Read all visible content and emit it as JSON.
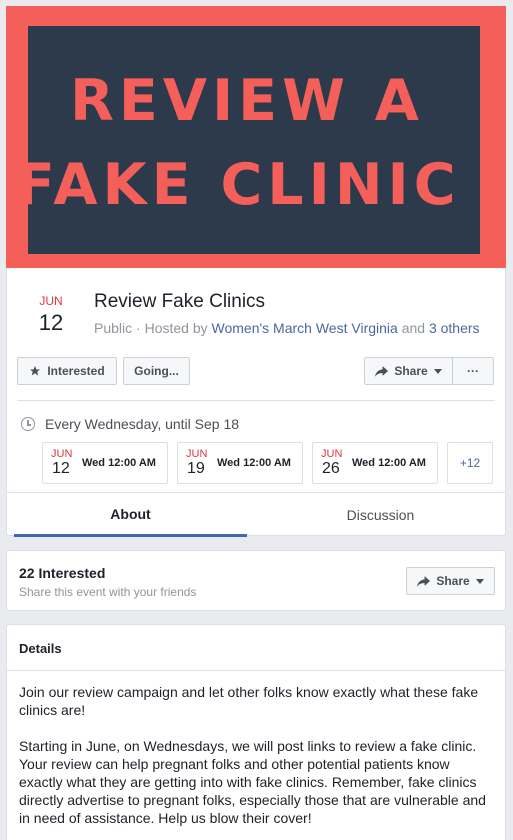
{
  "cover": {
    "line1": "REVIEW A",
    "line2": "FAKE CLINIC",
    "colors": {
      "frame": "#f45f5a",
      "panel": "#2c3a4b"
    }
  },
  "event": {
    "month": "JUN",
    "day": "12",
    "title": "Review Fake Clinics",
    "privacy": "Public",
    "hosted_by_prefix": " · Hosted by ",
    "host": "Women's March West Virginia",
    "and_text": " and ",
    "others": "3 others"
  },
  "actions": {
    "interested": "Interested",
    "going": "Going...",
    "share": "Share",
    "more": "···"
  },
  "recurrence": {
    "text": "Every Wednesday, until Sep 18",
    "occurrences": [
      {
        "month": "JUN",
        "day": "12",
        "time": "Wed 12:00 AM"
      },
      {
        "month": "JUN",
        "day": "19",
        "time": "Wed 12:00 AM"
      },
      {
        "month": "JUN",
        "day": "26",
        "time": "Wed 12:00 AM"
      }
    ],
    "more": "+12"
  },
  "tabs": [
    {
      "label": "About"
    },
    {
      "label": "Discussion"
    }
  ],
  "interested": {
    "count": "22 Interested",
    "subtitle": "Share this event with your friends",
    "share": "Share"
  },
  "details": {
    "title": "Details",
    "paragraphs": [
      "Join our review campaign and let other folks know exactly what these fake clinics are!",
      "Starting in June, on Wednesdays, we will post links to review a fake clinic. Your review can help pregnant folks and other potential patients know exactly what they are getting into with fake clinics. Remember, fake clinics directly advertise to pregnant folks, especially those that are vulnerable and in need of assistance. Help us blow their cover!"
    ]
  }
}
